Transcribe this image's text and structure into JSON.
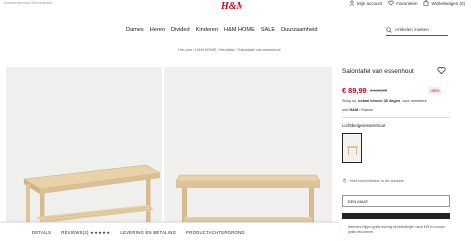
{
  "topbar": {
    "left_text": "Klantenservice   Nieuwsbrief",
    "account": "Mijn account",
    "favorites": "Favorieten",
    "cart": "Winkelwagen (0)"
  },
  "nav": {
    "items": [
      "Dames",
      "Heren",
      "Divided",
      "Kinderen",
      "H&M HOME",
      "SALE",
      "Duurzaamheid"
    ],
    "search_placeholder": "Artikelen zoeken"
  },
  "breadcrumb": "Hm.com / H&M HOME / Meubilair / Salontafel van essenhout",
  "product": {
    "name": "Salontafel van essenhout",
    "price": "€ 89,99",
    "old_price": "€ 199,00",
    "discount": "-55%",
    "promo_line1_pre": "Shop nu, ",
    "promo_line1_bold": "betaal binnen 30 dagen",
    "promo_line1_post": ", voor members",
    "promo_line2_pre": "met ",
    "promo_line2_brand": "H&M",
    "promo_line2_post": " • Klarna.",
    "color_label": "Lichtbeige/essenhout",
    "stock_text": "Niet beschikbaar in de winkels",
    "size_button": "EEN MAAT",
    "note": "Members krijgen gratis levering bij bestellingen vanaf €25 en kunnen gratis retourneren."
  },
  "bottombar": {
    "tabs": [
      "DETAILS",
      "REVIEWS(2) ★★★★★",
      "LEVERING EN BETALING",
      "PRODUCTACHTERGROND"
    ]
  },
  "colors": {
    "brand_red": "#d0021b",
    "text": "#222222",
    "image_bg": "#efefed",
    "wood": "#e6cfa5"
  }
}
